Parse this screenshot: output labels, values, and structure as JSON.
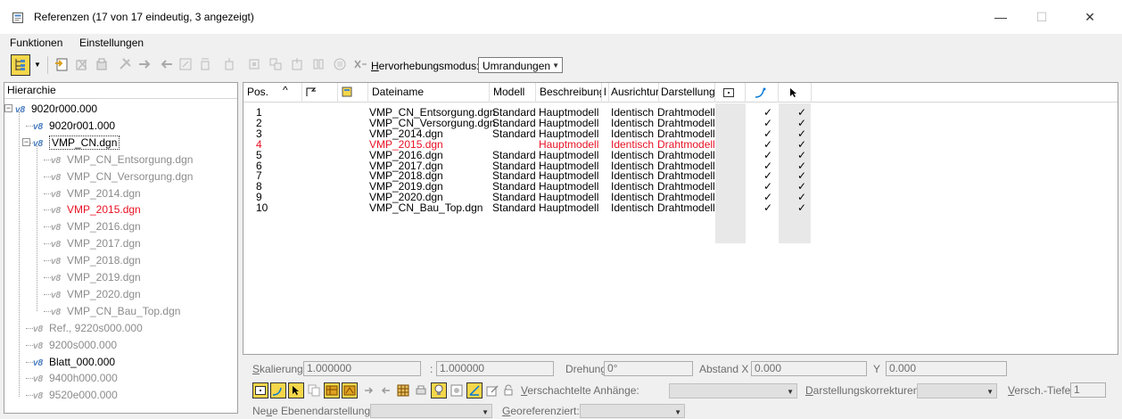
{
  "window": {
    "title": "Referenzen (17 von 17 eindeutig, 3 angezeigt)",
    "minimize": "—",
    "maximize": "☐",
    "close": "✕"
  },
  "menu": {
    "items": [
      "Funktionen",
      "Einstellungen"
    ]
  },
  "toolbar": {
    "highlight_label": "Hervorhebungsmodus:",
    "highlight_value": "Umrandungen"
  },
  "hierarchy": {
    "header": "Hierarchie",
    "nodes": [
      {
        "label": "9020r000.000",
        "state": "normal"
      },
      {
        "label": "9020r001.000",
        "state": "normal"
      },
      {
        "label": "VMP_CN.dgn",
        "state": "selected"
      },
      {
        "label": "VMP_CN_Entsorgung.dgn",
        "state": "gray"
      },
      {
        "label": "VMP_CN_Versorgung.dgn",
        "state": "gray"
      },
      {
        "label": "VMP_2014.dgn",
        "state": "gray"
      },
      {
        "label": "VMP_2015.dgn",
        "state": "red"
      },
      {
        "label": "VMP_2016.dgn",
        "state": "gray"
      },
      {
        "label": "VMP_2017.dgn",
        "state": "gray"
      },
      {
        "label": "VMP_2018.dgn",
        "state": "gray"
      },
      {
        "label": "VMP_2019.dgn",
        "state": "gray"
      },
      {
        "label": "VMP_2020.dgn",
        "state": "gray"
      },
      {
        "label": "VMP_CN_Bau_Top.dgn",
        "state": "gray"
      },
      {
        "label": "Ref., 9220s000.000",
        "state": "gray"
      },
      {
        "label": "9200s000.000",
        "state": "gray"
      },
      {
        "label": "Blatt_000.000",
        "state": "normal"
      },
      {
        "label": "9400h000.000",
        "state": "gray"
      },
      {
        "label": "9520e000.000",
        "state": "gray"
      }
    ]
  },
  "table": {
    "headers": {
      "pos": "Pos.",
      "sort_arrow": "^",
      "filename": "Dateiname",
      "model": "Modell",
      "description": "Beschreibung",
      "level": "l",
      "orientation": "Ausrichtur",
      "display": "Darstellung"
    },
    "rows": [
      {
        "pos": "1",
        "file": "VMP_CN_Entsorgung.dgn",
        "model": "Standard",
        "desc": "Hauptmodell",
        "orient": "Identisch",
        "display": "Drahtmodell",
        "c1": "✓",
        "c2": "✓",
        "red": false
      },
      {
        "pos": "2",
        "file": "VMP_CN_Versorgung.dgn",
        "model": "Standard",
        "desc": "Hauptmodell",
        "orient": "Identisch",
        "display": "Drahtmodell",
        "c1": "✓",
        "c2": "✓",
        "red": false
      },
      {
        "pos": "3",
        "file": "VMP_2014.dgn",
        "model": "Standard",
        "desc": "Hauptmodell",
        "orient": "Identisch",
        "display": "Drahtmodell",
        "c1": "✓",
        "c2": "✓",
        "red": false
      },
      {
        "pos": "4",
        "file": "VMP_2015.dgn",
        "model": "",
        "desc": "Hauptmodell",
        "orient": "Identisch",
        "display": "Drahtmodell",
        "c1": "✓",
        "c2": "✓",
        "red": true
      },
      {
        "pos": "5",
        "file": "VMP_2016.dgn",
        "model": "Standard",
        "desc": "Hauptmodell",
        "orient": "Identisch",
        "display": "Drahtmodell",
        "c1": "✓",
        "c2": "✓",
        "red": false
      },
      {
        "pos": "6",
        "file": "VMP_2017.dgn",
        "model": "Standard",
        "desc": "Hauptmodell",
        "orient": "Identisch",
        "display": "Drahtmodell",
        "c1": "✓",
        "c2": "✓",
        "red": false
      },
      {
        "pos": "7",
        "file": "VMP_2018.dgn",
        "model": "Standard",
        "desc": "Hauptmodell",
        "orient": "Identisch",
        "display": "Drahtmodell",
        "c1": "✓",
        "c2": "✓",
        "red": false
      },
      {
        "pos": "8",
        "file": "VMP_2019.dgn",
        "model": "Standard",
        "desc": "Hauptmodell",
        "orient": "Identisch",
        "display": "Drahtmodell",
        "c1": "✓",
        "c2": "✓",
        "red": false
      },
      {
        "pos": "9",
        "file": "VMP_2020.dgn",
        "model": "Standard",
        "desc": "Hauptmodell",
        "orient": "Identisch",
        "display": "Drahtmodell",
        "c1": "✓",
        "c2": "✓",
        "red": false
      },
      {
        "pos": "10",
        "file": "VMP_CN_Bau_Top.dgn",
        "model": "Standard",
        "desc": "Hauptmodell",
        "orient": "Identisch",
        "display": "Drahtmodell",
        "c1": "✓",
        "c2": "✓",
        "red": false
      }
    ]
  },
  "settings": {
    "scale_label": "Skalierung",
    "scale_value1": "1.000000",
    "scale_sep": ":",
    "scale_value2": "1.000000",
    "rotation_label": "Drehung",
    "rotation_value": "0°",
    "offset_x_label": "Abstand X",
    "offset_x_value": "0.000",
    "offset_y_label": "Y",
    "offset_y_value": "0.000",
    "nested_label": "Verschachtelte Anhänge:",
    "display_corr_label": "Darstellungskorrekturen:",
    "depth_label": "Versch.-Tiefe:",
    "depth_value": "1",
    "new_level_label": "Neue Ebenendarstellung:",
    "georef_label": "Georeferenziert:"
  },
  "colors": {
    "accent": "#0078d7",
    "red": "#e81123",
    "gray_text": "#8c8c8c"
  }
}
